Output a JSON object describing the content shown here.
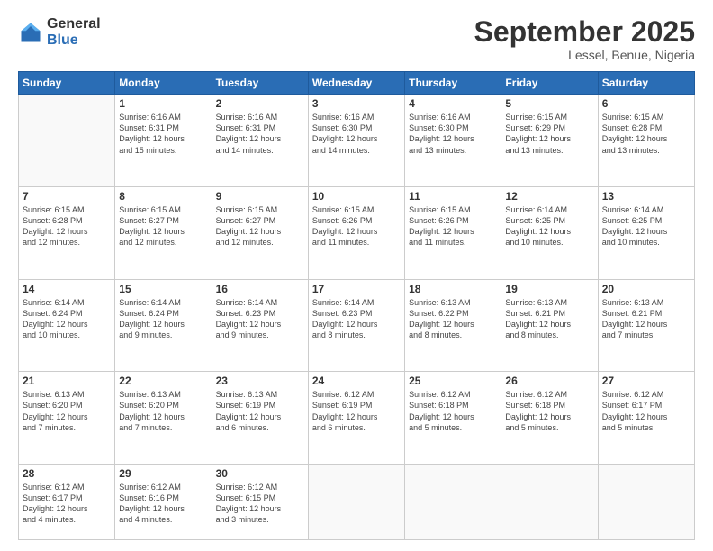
{
  "logo": {
    "general": "General",
    "blue": "Blue"
  },
  "header": {
    "month": "September 2025",
    "location": "Lessel, Benue, Nigeria"
  },
  "weekdays": [
    "Sunday",
    "Monday",
    "Tuesday",
    "Wednesday",
    "Thursday",
    "Friday",
    "Saturday"
  ],
  "weeks": [
    [
      {
        "day": "",
        "info": ""
      },
      {
        "day": "1",
        "info": "Sunrise: 6:16 AM\nSunset: 6:31 PM\nDaylight: 12 hours\nand 15 minutes."
      },
      {
        "day": "2",
        "info": "Sunrise: 6:16 AM\nSunset: 6:31 PM\nDaylight: 12 hours\nand 14 minutes."
      },
      {
        "day": "3",
        "info": "Sunrise: 6:16 AM\nSunset: 6:30 PM\nDaylight: 12 hours\nand 14 minutes."
      },
      {
        "day": "4",
        "info": "Sunrise: 6:16 AM\nSunset: 6:30 PM\nDaylight: 12 hours\nand 13 minutes."
      },
      {
        "day": "5",
        "info": "Sunrise: 6:15 AM\nSunset: 6:29 PM\nDaylight: 12 hours\nand 13 minutes."
      },
      {
        "day": "6",
        "info": "Sunrise: 6:15 AM\nSunset: 6:28 PM\nDaylight: 12 hours\nand 13 minutes."
      }
    ],
    [
      {
        "day": "7",
        "info": "Sunrise: 6:15 AM\nSunset: 6:28 PM\nDaylight: 12 hours\nand 12 minutes."
      },
      {
        "day": "8",
        "info": "Sunrise: 6:15 AM\nSunset: 6:27 PM\nDaylight: 12 hours\nand 12 minutes."
      },
      {
        "day": "9",
        "info": "Sunrise: 6:15 AM\nSunset: 6:27 PM\nDaylight: 12 hours\nand 12 minutes."
      },
      {
        "day": "10",
        "info": "Sunrise: 6:15 AM\nSunset: 6:26 PM\nDaylight: 12 hours\nand 11 minutes."
      },
      {
        "day": "11",
        "info": "Sunrise: 6:15 AM\nSunset: 6:26 PM\nDaylight: 12 hours\nand 11 minutes."
      },
      {
        "day": "12",
        "info": "Sunrise: 6:14 AM\nSunset: 6:25 PM\nDaylight: 12 hours\nand 10 minutes."
      },
      {
        "day": "13",
        "info": "Sunrise: 6:14 AM\nSunset: 6:25 PM\nDaylight: 12 hours\nand 10 minutes."
      }
    ],
    [
      {
        "day": "14",
        "info": "Sunrise: 6:14 AM\nSunset: 6:24 PM\nDaylight: 12 hours\nand 10 minutes."
      },
      {
        "day": "15",
        "info": "Sunrise: 6:14 AM\nSunset: 6:24 PM\nDaylight: 12 hours\nand 9 minutes."
      },
      {
        "day": "16",
        "info": "Sunrise: 6:14 AM\nSunset: 6:23 PM\nDaylight: 12 hours\nand 9 minutes."
      },
      {
        "day": "17",
        "info": "Sunrise: 6:14 AM\nSunset: 6:23 PM\nDaylight: 12 hours\nand 8 minutes."
      },
      {
        "day": "18",
        "info": "Sunrise: 6:13 AM\nSunset: 6:22 PM\nDaylight: 12 hours\nand 8 minutes."
      },
      {
        "day": "19",
        "info": "Sunrise: 6:13 AM\nSunset: 6:21 PM\nDaylight: 12 hours\nand 8 minutes."
      },
      {
        "day": "20",
        "info": "Sunrise: 6:13 AM\nSunset: 6:21 PM\nDaylight: 12 hours\nand 7 minutes."
      }
    ],
    [
      {
        "day": "21",
        "info": "Sunrise: 6:13 AM\nSunset: 6:20 PM\nDaylight: 12 hours\nand 7 minutes."
      },
      {
        "day": "22",
        "info": "Sunrise: 6:13 AM\nSunset: 6:20 PM\nDaylight: 12 hours\nand 7 minutes."
      },
      {
        "day": "23",
        "info": "Sunrise: 6:13 AM\nSunset: 6:19 PM\nDaylight: 12 hours\nand 6 minutes."
      },
      {
        "day": "24",
        "info": "Sunrise: 6:12 AM\nSunset: 6:19 PM\nDaylight: 12 hours\nand 6 minutes."
      },
      {
        "day": "25",
        "info": "Sunrise: 6:12 AM\nSunset: 6:18 PM\nDaylight: 12 hours\nand 5 minutes."
      },
      {
        "day": "26",
        "info": "Sunrise: 6:12 AM\nSunset: 6:18 PM\nDaylight: 12 hours\nand 5 minutes."
      },
      {
        "day": "27",
        "info": "Sunrise: 6:12 AM\nSunset: 6:17 PM\nDaylight: 12 hours\nand 5 minutes."
      }
    ],
    [
      {
        "day": "28",
        "info": "Sunrise: 6:12 AM\nSunset: 6:17 PM\nDaylight: 12 hours\nand 4 minutes."
      },
      {
        "day": "29",
        "info": "Sunrise: 6:12 AM\nSunset: 6:16 PM\nDaylight: 12 hours\nand 4 minutes."
      },
      {
        "day": "30",
        "info": "Sunrise: 6:12 AM\nSunset: 6:15 PM\nDaylight: 12 hours\nand 3 minutes."
      },
      {
        "day": "",
        "info": ""
      },
      {
        "day": "",
        "info": ""
      },
      {
        "day": "",
        "info": ""
      },
      {
        "day": "",
        "info": ""
      }
    ]
  ]
}
